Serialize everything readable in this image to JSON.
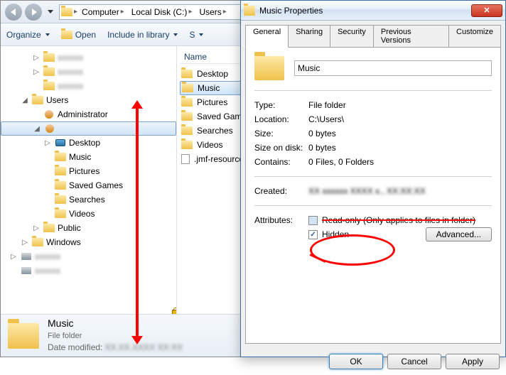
{
  "nav": {
    "crumbs": [
      "Computer",
      "Local Disk (C:)",
      "Users"
    ]
  },
  "toolbar": {
    "organize": "Organize",
    "open": "Open",
    "include": "Include in library",
    "share": "S"
  },
  "tree": {
    "items": [
      {
        "indent": 1,
        "toggle": "▷",
        "label": "",
        "blurred": true,
        "ico": "folder"
      },
      {
        "indent": 1,
        "toggle": "▷",
        "label": "",
        "blurred": true,
        "ico": "folder"
      },
      {
        "indent": 1,
        "toggle": "",
        "label": "",
        "blurred": true,
        "ico": "folder"
      },
      {
        "indent": 0,
        "toggle": "◢",
        "label": "Users",
        "ico": "folder"
      },
      {
        "indent": 1,
        "toggle": "",
        "label": "Administrator",
        "ico": "user"
      },
      {
        "indent": 1,
        "toggle": "◢",
        "label": "",
        "ico": "user",
        "sel": true,
        "lock": true
      },
      {
        "indent": 2,
        "toggle": "▷",
        "label": "Desktop",
        "ico": "desktop"
      },
      {
        "indent": 2,
        "toggle": "",
        "label": "Music",
        "ico": "folder"
      },
      {
        "indent": 2,
        "toggle": "",
        "label": "Pictures",
        "ico": "folder"
      },
      {
        "indent": 2,
        "toggle": "",
        "label": "Saved Games",
        "ico": "folder"
      },
      {
        "indent": 2,
        "toggle": "",
        "label": "Searches",
        "ico": "folder"
      },
      {
        "indent": 2,
        "toggle": "",
        "label": "Videos",
        "ico": "folder"
      },
      {
        "indent": 1,
        "toggle": "▷",
        "label": "Public",
        "ico": "folder"
      },
      {
        "indent": 0,
        "toggle": "▷",
        "label": "Windows",
        "ico": "folder"
      },
      {
        "indent": -1,
        "toggle": "▷",
        "label": "",
        "blurred": true,
        "ico": "disk"
      },
      {
        "indent": -1,
        "toggle": "",
        "label": "",
        "blurred": true,
        "ico": "disk"
      }
    ]
  },
  "filelist": {
    "header": "Name",
    "rows": [
      {
        "label": "Desktop",
        "ico": "folder"
      },
      {
        "label": "Music",
        "ico": "folder",
        "sel": true
      },
      {
        "label": "Pictures",
        "ico": "folder"
      },
      {
        "label": "Saved Games",
        "ico": "folder"
      },
      {
        "label": "Searches",
        "ico": "folder"
      },
      {
        "label": "Videos",
        "ico": "folder"
      },
      {
        "label": ".jmf-resource",
        "ico": "doc"
      }
    ]
  },
  "details": {
    "title": "Music",
    "type": "File folder",
    "modified_label": "Date modified:",
    "modified_value": ""
  },
  "dialog": {
    "title": "Music Properties",
    "close": "✕",
    "tabs": [
      "General",
      "Sharing",
      "Security",
      "Previous Versions",
      "Customize"
    ],
    "name_value": "Music",
    "rows": [
      {
        "label": "Type:",
        "value": "File folder"
      },
      {
        "label": "Location:",
        "value": "C:\\Users\\"
      },
      {
        "label": "Size:",
        "value": "0 bytes"
      },
      {
        "label": "Size on disk:",
        "value": "0 bytes"
      },
      {
        "label": "Contains:",
        "value": "0 Files, 0 Folders"
      }
    ],
    "created_label": "Created:",
    "created_value": "",
    "attributes_label": "Attributes:",
    "readonly": "Read-only (Only applies to files in folder)",
    "hidden": "Hidden",
    "advanced": "Advanced...",
    "ok": "OK",
    "cancel": "Cancel",
    "apply": "Apply"
  }
}
